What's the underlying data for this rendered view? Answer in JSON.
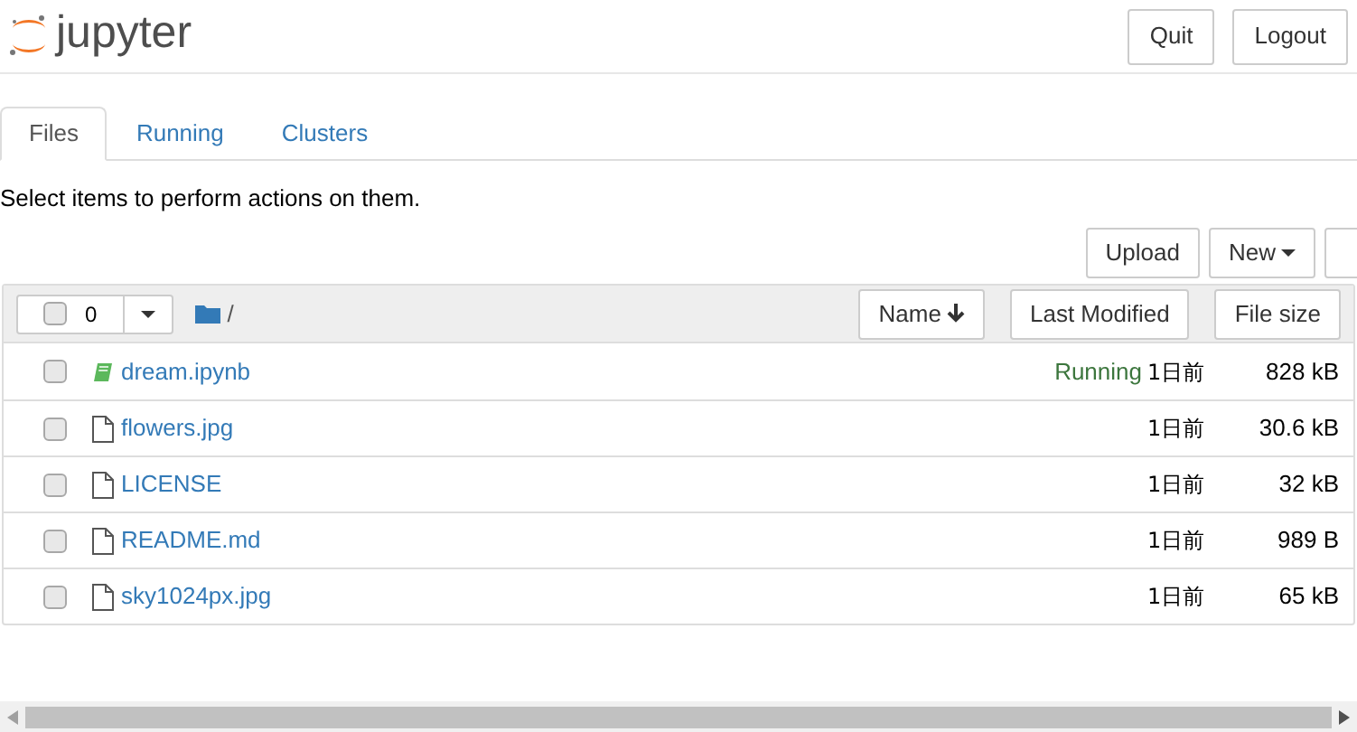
{
  "header": {
    "logo_text": "jupyter",
    "buttons": [
      "Quit",
      "Logout"
    ]
  },
  "tabs": [
    {
      "label": "Files",
      "selected": true
    },
    {
      "label": "Running",
      "selected": false
    },
    {
      "label": "Clusters",
      "selected": false
    }
  ],
  "instructions": "Select items to perform actions on them.",
  "toolbar": {
    "upload": "Upload",
    "new": "New"
  },
  "list_header": {
    "select_all_checked": false,
    "selected_count": "0",
    "path": "/",
    "sort_buttons": [
      "Name",
      "Last Modified",
      "File size"
    ]
  },
  "files": [
    {
      "name": "dream.ipynb",
      "kind": "notebook",
      "checked": false,
      "status": "Running",
      "modified": "1日前",
      "size": "828 kB"
    },
    {
      "name": "flowers.jpg",
      "kind": "file",
      "checked": false,
      "modified": "1日前",
      "size": "30.6 kB"
    },
    {
      "name": "LICENSE",
      "kind": "file",
      "checked": false,
      "modified": "1日前",
      "size": "32 kB"
    },
    {
      "name": "README.md",
      "kind": "file",
      "checked": false,
      "modified": "1日前",
      "size": "989 B"
    },
    {
      "name": "sky1024px.jpg",
      "kind": "file",
      "checked": false,
      "modified": "1日前",
      "size": "65 kB"
    }
  ]
}
